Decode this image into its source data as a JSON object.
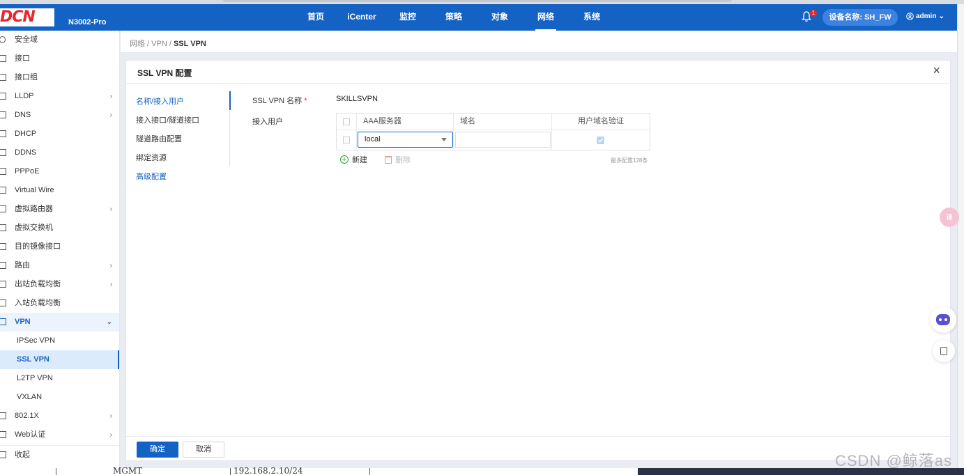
{
  "header": {
    "logo": "DCN",
    "model": "N3002-Pro",
    "nav": [
      "首页",
      "iCenter",
      "监控",
      "策略",
      "对象",
      "网络",
      "系统"
    ],
    "active_nav": "网络",
    "notification_count": "1",
    "device_label": "设备名称: SH_FW",
    "user": "admin",
    "colors": {
      "primary": "#1462c4",
      "logo": "#e8262b"
    }
  },
  "sidebar": {
    "items": [
      {
        "label": "安全域",
        "icon": "globe-icon",
        "chevron": ""
      },
      {
        "label": "接口",
        "icon": "interface-icon",
        "chevron": ""
      },
      {
        "label": "接口组",
        "icon": "interface-group-icon",
        "chevron": ""
      },
      {
        "label": "LLDP",
        "icon": "",
        "chevron": "›"
      },
      {
        "label": "DNS",
        "icon": "",
        "chevron": "›"
      },
      {
        "label": "DHCP",
        "icon": "",
        "chevron": ""
      },
      {
        "label": "DDNS",
        "icon": "",
        "chevron": ""
      },
      {
        "label": "PPPoE",
        "icon": "",
        "chevron": ""
      },
      {
        "label": "Virtual Wire",
        "icon": "virtual-wire-icon",
        "chevron": ""
      },
      {
        "label": "虚拟路由器",
        "icon": "router-icon",
        "chevron": "›"
      },
      {
        "label": "虚拟交换机",
        "icon": "switch-icon",
        "chevron": ""
      },
      {
        "label": "目的镜像接口",
        "icon": "mirror-icon",
        "chevron": ""
      },
      {
        "label": "路由",
        "icon": "route-icon",
        "chevron": "›"
      },
      {
        "label": "出站负载均衡",
        "icon": "outbound-lb-icon",
        "chevron": "›"
      },
      {
        "label": "入站负载均衡",
        "icon": "inbound-lb-icon",
        "chevron": ""
      }
    ],
    "vpn_group": {
      "label": "VPN",
      "chevron": "⌄"
    },
    "vpn_sub": [
      "IPSec VPN",
      "SSL VPN",
      "L2TP VPN",
      "VXLAN"
    ],
    "vpn_active": "SSL VPN",
    "after": [
      {
        "label": "802.1X",
        "chevron": "›"
      },
      {
        "label": "Web认证",
        "chevron": "›"
      }
    ],
    "collapse": "收起"
  },
  "breadcrumb": {
    "prefix": "网络 / VPN / ",
    "current": "SSL VPN"
  },
  "panel": {
    "title": "SSL VPN 配置",
    "steps": [
      "名称/接入用户",
      "接入接口/隧道接口",
      "隧道路由配置",
      "绑定资源",
      "高级配置"
    ],
    "active_step": "名称/接入用户",
    "name_label": "SSL VPN 名称",
    "name_required": "*",
    "name_value": "SKILLSVPN",
    "users_label": "接入用户",
    "table": {
      "headers": [
        "AAA服务器",
        "域名",
        "用户域名验证"
      ],
      "rows": [
        {
          "aaa_server": "local",
          "domain": "",
          "verify": true
        }
      ]
    },
    "add_label": "新建",
    "delete_label": "删除",
    "max_note": "最多配置128条",
    "ok_label": "确定",
    "cancel_label": "取消"
  },
  "floating": {
    "translate_badge": "译"
  },
  "background": {
    "left_text": "MGMT",
    "right_text": "192.168.2.10/24",
    "watermark": "CSDN @鲸落as"
  }
}
